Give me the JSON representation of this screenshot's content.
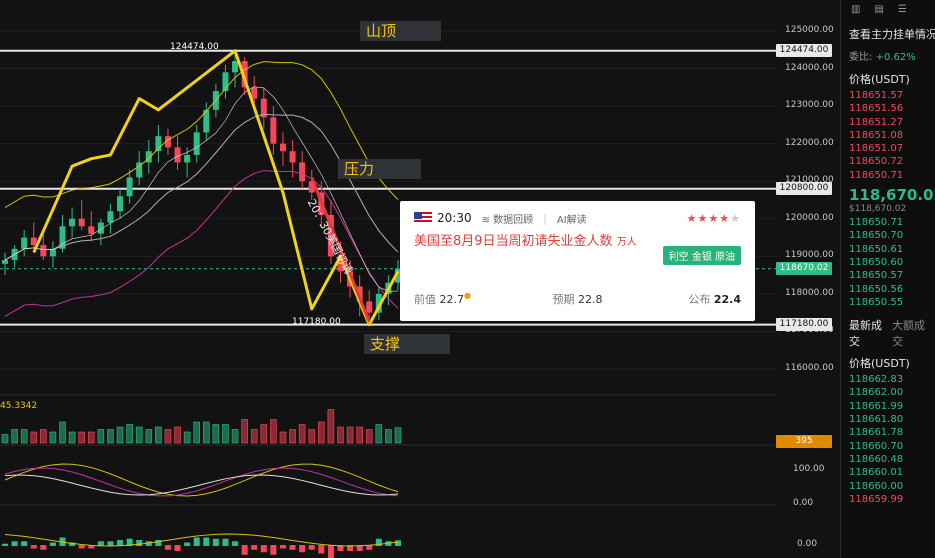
{
  "chart_data": {
    "type": "candlestick",
    "symbol_price": "118670.02",
    "y_axis_ticks": [
      "125000.00",
      "124000.00",
      "123000.00",
      "122000.00",
      "121000.00",
      "120000.00",
      "119000.00",
      "118000.00",
      "117000.00",
      "116000.00"
    ],
    "levels": [
      {
        "name": "山顶",
        "value": 124474.0,
        "label": "124474.00"
      },
      {
        "name": "压力",
        "value": 120800.0,
        "label": "120800.00"
      },
      {
        "name": "支撑",
        "value": 117180.0,
        "label": "117180.00"
      }
    ],
    "current_price_label": "118670.02",
    "high_label": "124474.00",
    "low_label": "117180.00",
    "annotation": "20：30美国初请",
    "zones": {
      "top": "山顶",
      "pressure": "压力",
      "support": "支撑"
    },
    "volume": {
      "ma_value": "45.3342",
      "current_volume": "395"
    },
    "oscillator1_ticks": [
      "100.00",
      "0.00"
    ],
    "oscillator2_ticks": [
      "0.00"
    ],
    "candles": [
      [
        118800,
        119100,
        118500,
        118900
      ],
      [
        118900,
        119300,
        118700,
        119200
      ],
      [
        119200,
        119700,
        119000,
        119500
      ],
      [
        119500,
        119900,
        119200,
        119300
      ],
      [
        119300,
        119600,
        118900,
        119000
      ],
      [
        119000,
        119400,
        118700,
        119200
      ],
      [
        119200,
        120100,
        119100,
        119800
      ],
      [
        119800,
        120300,
        119500,
        120000
      ],
      [
        120000,
        120500,
        119700,
        119800
      ],
      [
        119800,
        120200,
        119400,
        119600
      ],
      [
        119600,
        120000,
        119300,
        119900
      ],
      [
        119900,
        120400,
        119600,
        120200
      ],
      [
        120200,
        120800,
        120000,
        120600
      ],
      [
        120600,
        121300,
        120400,
        121100
      ],
      [
        121100,
        121800,
        120900,
        121500
      ],
      [
        121500,
        122100,
        121200,
        121800
      ],
      [
        121800,
        122500,
        121500,
        122200
      ],
      [
        122200,
        122400,
        121700,
        121900
      ],
      [
        121900,
        122200,
        121300,
        121500
      ],
      [
        121500,
        121900,
        121100,
        121700
      ],
      [
        121700,
        122500,
        121500,
        122300
      ],
      [
        122300,
        123100,
        122100,
        122900
      ],
      [
        122900,
        123600,
        122700,
        123400
      ],
      [
        123400,
        124100,
        123200,
        123900
      ],
      [
        123900,
        124474,
        123500,
        124200
      ],
      [
        124200,
        124300,
        123300,
        123500
      ],
      [
        123500,
        123800,
        122900,
        123200
      ],
      [
        123200,
        123500,
        122400,
        122700
      ],
      [
        122700,
        123000,
        121700,
        122000
      ],
      [
        122000,
        122300,
        121400,
        121800
      ],
      [
        121800,
        122100,
        121100,
        121500
      ],
      [
        121500,
        121800,
        120800,
        121000
      ],
      [
        121000,
        121300,
        120500,
        120700
      ],
      [
        120700,
        121000,
        119800,
        120100
      ],
      [
        120100,
        120500,
        118800,
        119000
      ],
      [
        119000,
        119400,
        118300,
        118600
      ],
      [
        118600,
        118900,
        117900,
        118200
      ],
      [
        118200,
        118500,
        117400,
        117800
      ],
      [
        117800,
        118100,
        117180,
        117500
      ],
      [
        117500,
        118200,
        117300,
        118000
      ],
      [
        118000,
        118500,
        117700,
        118300
      ],
      [
        118300,
        118900,
        118100,
        118670
      ]
    ]
  },
  "popup": {
    "time": "20:30",
    "link_review": "数据回顾",
    "link_ai": "AI解读",
    "stars_total": 5,
    "stars_on": 4,
    "title": "美国至8月9日当周初请失业金人数",
    "unit": "万人",
    "tag": "利空 金银 原油",
    "prev_label": "前值",
    "prev_value": "22.7",
    "forecast_label": "预期",
    "forecast_value": "22.8",
    "actual_label": "公布",
    "actual_value": "22.4"
  },
  "sidebar": {
    "title": "查看主力挂单情况",
    "ratio_label": "委比:",
    "ratio_value": "+0.62%",
    "price_header": "价格(USDT)",
    "asks": [
      "118651.57",
      "118651.56",
      "118651.27",
      "118651.08",
      "118651.07",
      "118650.72",
      "118650.71"
    ],
    "last_price": "118,670.02",
    "last_price_sub": "$118,670.02",
    "bids": [
      "118650.71",
      "118650.70",
      "118650.61",
      "118650.60",
      "118650.57",
      "118650.56",
      "118650.55"
    ],
    "tab_trades": "最新成交",
    "tab_large": "大额成交",
    "trades_header": "价格(USDT)",
    "trades": [
      "118662.83",
      "118662.00",
      "118661.99",
      "118661.80",
      "118661.78",
      "118660.70",
      "118660.48",
      "118660.01",
      "118660.00",
      "118659.99"
    ]
  },
  "colors": {
    "up": "#2ebd85",
    "down": "#f6465d",
    "accent": "#f1c40f",
    "background": "#121212"
  }
}
